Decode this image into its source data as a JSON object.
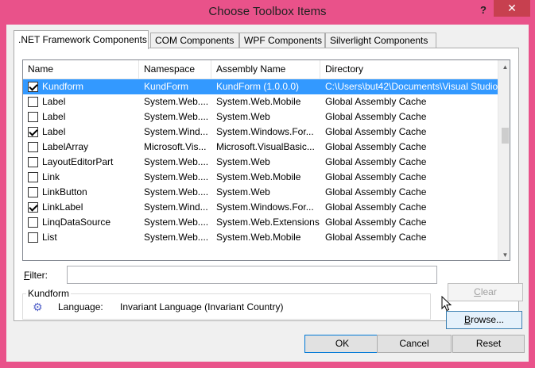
{
  "window": {
    "title": "Choose Toolbox Items",
    "help_glyph": "?",
    "close_glyph": "✕"
  },
  "tabs": [
    {
      "label": ".NET Framework Components",
      "active": true
    },
    {
      "label": "COM Components",
      "active": false
    },
    {
      "label": "WPF Components",
      "active": false
    },
    {
      "label": "Silverlight Components",
      "active": false
    }
  ],
  "grid": {
    "columns": [
      "Name",
      "Namespace",
      "Assembly Name",
      "Directory"
    ],
    "rows": [
      {
        "checked": true,
        "name": "Kundform",
        "namespace": "KundForm",
        "assembly": "KundForm (1.0.0.0)",
        "directory": "C:\\Users\\but42\\Documents\\Visual Studio",
        "selected": true
      },
      {
        "checked": false,
        "name": "Label",
        "namespace": "System.Web....",
        "assembly": "System.Web.Mobile",
        "directory": "Global Assembly Cache"
      },
      {
        "checked": false,
        "name": "Label",
        "namespace": "System.Web....",
        "assembly": "System.Web",
        "directory": "Global Assembly Cache"
      },
      {
        "checked": true,
        "name": "Label",
        "namespace": "System.Wind...",
        "assembly": "System.Windows.For...",
        "directory": "Global Assembly Cache"
      },
      {
        "checked": false,
        "name": "LabelArray",
        "namespace": "Microsoft.Vis...",
        "assembly": "Microsoft.VisualBasic...",
        "directory": "Global Assembly Cache"
      },
      {
        "checked": false,
        "name": "LayoutEditorPart",
        "namespace": "System.Web....",
        "assembly": "System.Web",
        "directory": "Global Assembly Cache"
      },
      {
        "checked": false,
        "name": "Link",
        "namespace": "System.Web....",
        "assembly": "System.Web.Mobile",
        "directory": "Global Assembly Cache"
      },
      {
        "checked": false,
        "name": "LinkButton",
        "namespace": "System.Web....",
        "assembly": "System.Web",
        "directory": "Global Assembly Cache"
      },
      {
        "checked": true,
        "name": "LinkLabel",
        "namespace": "System.Wind...",
        "assembly": "System.Windows.For...",
        "directory": "Global Assembly Cache"
      },
      {
        "checked": false,
        "name": "LinqDataSource",
        "namespace": "System.Web....",
        "assembly": "System.Web.Extensions",
        "directory": "Global Assembly Cache"
      },
      {
        "checked": false,
        "name": "List",
        "namespace": "System.Web....",
        "assembly": "System.Web.Mobile",
        "directory": "Global Assembly Cache"
      }
    ]
  },
  "filter": {
    "label_prefix": "",
    "label_accel": "F",
    "label_rest": "ilter:",
    "value": ""
  },
  "buttons": {
    "clear": {
      "accel": "C",
      "rest": "lear"
    },
    "browse": {
      "accel": "B",
      "rest": "rowse..."
    },
    "ok": "OK",
    "cancel": "Cancel",
    "reset": "Reset"
  },
  "details": {
    "title": "Kundform",
    "language_label": "Language:",
    "language_value": "Invariant Language (Invariant Country)"
  },
  "colors": {
    "selection": "#3399ff",
    "frame": "#e9528a",
    "close": "#c7404f"
  }
}
